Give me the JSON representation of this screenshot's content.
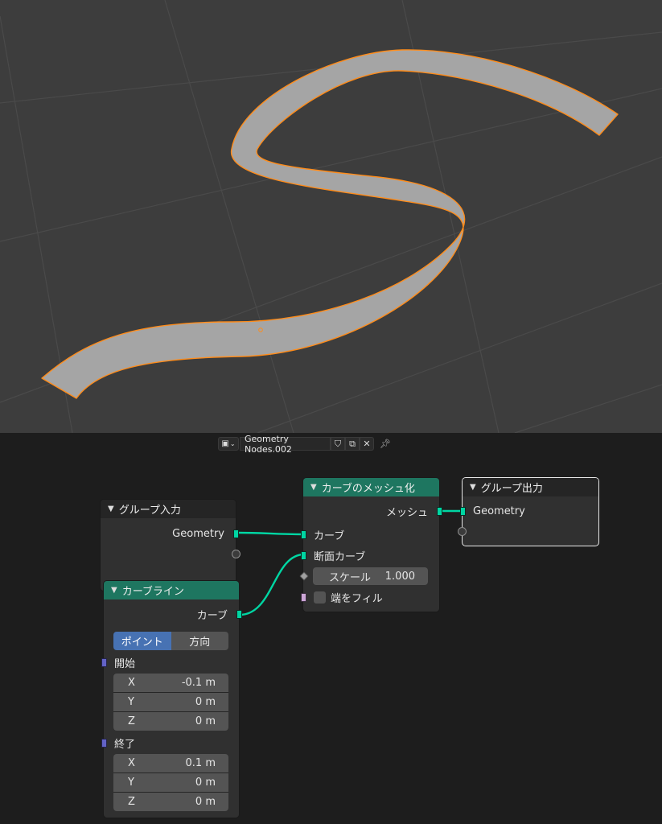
{
  "viewport": {
    "background": "#3d3d3d",
    "curve_fill": "#a5a5a5",
    "curve_outline": "#ff8c1a"
  },
  "editor_header": {
    "node_tree_name": "Geometry Nodes.002",
    "icons": [
      "node-tree-type-icon",
      "chevron-down-icon",
      "fake-user-shield-icon",
      "duplicate-icon",
      "close-icon",
      "pin-icon"
    ]
  },
  "nodes": {
    "group_input": {
      "title": "グループ入力",
      "outputs": [
        "Geometry"
      ]
    },
    "curve_line": {
      "title": "カーブライン",
      "output": "カーブ",
      "mode_options": [
        "ポイント",
        "方向"
      ],
      "mode_selected": "ポイント",
      "start_label": "開始",
      "start": [
        {
          "axis": "X",
          "value": "-0.1 m"
        },
        {
          "axis": "Y",
          "value": "0 m"
        },
        {
          "axis": "Z",
          "value": "0 m"
        }
      ],
      "end_label": "終了",
      "end": [
        {
          "axis": "X",
          "value": "0.1 m"
        },
        {
          "axis": "Y",
          "value": "0 m"
        },
        {
          "axis": "Z",
          "value": "0 m"
        }
      ]
    },
    "curve_to_mesh": {
      "title": "カーブのメッシュ化",
      "output": "メッシュ",
      "input_curve": "カーブ",
      "input_profile": "断面カーブ",
      "scale_label": "スケール",
      "scale_value": "1.000",
      "fill_caps_label": "端をフィル",
      "fill_caps": false
    },
    "group_output": {
      "title": "グループ出力",
      "inputs": [
        "Geometry"
      ]
    }
  },
  "colors": {
    "geometry_socket": "#00d6a3",
    "vector_socket": "#6363c7",
    "bool_socket": "#cca6d6",
    "geometry_node_header": "#1e7660",
    "input_node_header": "#252525",
    "toggle_active": "#4772b3"
  }
}
